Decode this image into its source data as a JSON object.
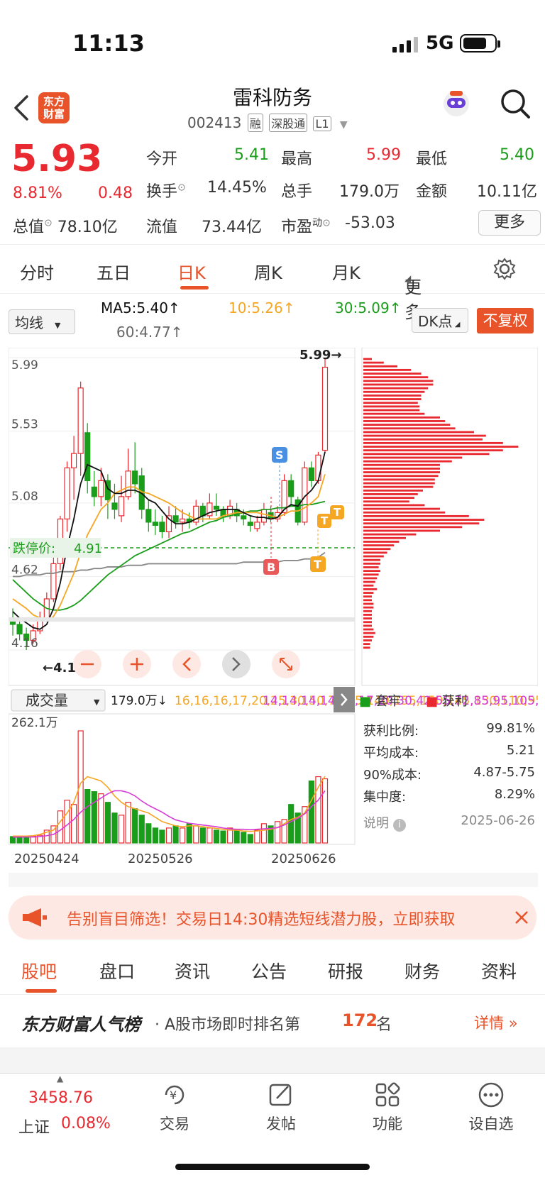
{
  "status_bar": {
    "time": "11:13",
    "network": "5G"
  },
  "header": {
    "logo_line1": "东方",
    "logo_line2": "财富",
    "title": "雷科防务",
    "code": "002413",
    "tags": [
      "融",
      "深股通",
      "L1"
    ]
  },
  "quote": {
    "price": "5.93",
    "change_pct": "8.81%",
    "change": "0.48",
    "open_label": "今开",
    "open": "5.41",
    "high_label": "最高",
    "high": "5.99",
    "low_label": "最低",
    "low": "5.40",
    "turnover_label": "换手",
    "turnover": "14.45%",
    "volume_label": "总手",
    "volume": "179.0万",
    "amount_label": "金额",
    "amount": "10.11亿",
    "total_cap_label": "总值",
    "total_cap": "78.10亿",
    "float_cap_label": "流值",
    "float_cap": "73.44亿",
    "pe_label": "市盈",
    "pe_sup": "动",
    "pe": "-53.03",
    "more_label": "更多"
  },
  "chart_tabs": [
    "分时",
    "五日",
    "日K",
    "周K",
    "月K",
    "更多"
  ],
  "active_chart_tab": "日K",
  "ma_bar": {
    "selector": "均线",
    "ma5": "MA5:5.40↑",
    "ma10": "10:5.26↑",
    "ma30": "30:5.09↑",
    "ma60": "60:4.77↑",
    "dk_label": "DK点",
    "adjust_label": "不复权"
  },
  "colors": {
    "up": "#e8292f",
    "down": "#1a9d1a",
    "accent": "#e8532a",
    "ma5": "#111111",
    "ma10": "#f5a623",
    "ma30": "#1a9d1a",
    "ma60": "#888888",
    "vol_ma2": "#d63bd6"
  },
  "chart_data": {
    "type": "candlestick",
    "y_ticks": [
      "5.99",
      "5.53",
      "5.08",
      "4.62",
      "4.16"
    ],
    "ylim": [
      4.16,
      5.99
    ],
    "high_marker": "5.99→",
    "low_marker": "←4.16",
    "limit_down_label": "跌停价:",
    "limit_down_value": "4.91",
    "signal_labels": [
      "S",
      "B",
      "T",
      "T",
      "T"
    ],
    "x_labels": [
      "20250424",
      "20250526",
      "20250626"
    ],
    "candles": [
      [
        4.35,
        4.32,
        4.42,
        4.25
      ],
      [
        4.32,
        4.26,
        4.36,
        4.22
      ],
      [
        4.26,
        4.22,
        4.3,
        4.16
      ],
      [
        4.22,
        4.28,
        4.32,
        4.2
      ],
      [
        4.28,
        4.36,
        4.4,
        4.26
      ],
      [
        4.36,
        4.48,
        4.52,
        4.34
      ],
      [
        4.48,
        4.7,
        4.74,
        4.46
      ],
      [
        4.7,
        4.98,
        5.0,
        4.66
      ],
      [
        4.98,
        5.3,
        5.34,
        4.9
      ],
      [
        5.3,
        5.39,
        5.5,
        5.1
      ],
      [
        5.39,
        5.8,
        5.84,
        5.25
      ],
      [
        5.52,
        5.22,
        5.58,
        5.14
      ],
      [
        5.18,
        5.12,
        5.28,
        5.06
      ],
      [
        5.12,
        5.22,
        5.3,
        5.06
      ],
      [
        5.22,
        5.1,
        5.26,
        4.98
      ],
      [
        5.08,
        5.04,
        5.2,
        4.98
      ],
      [
        5.0,
        5.12,
        5.25,
        4.96
      ],
      [
        5.12,
        5.28,
        5.42,
        5.1
      ],
      [
        5.28,
        5.2,
        5.46,
        5.14
      ],
      [
        5.25,
        5.04,
        5.3,
        4.98
      ],
      [
        5.04,
        4.96,
        5.1,
        4.9
      ],
      [
        4.96,
        4.94,
        5.04,
        4.88
      ],
      [
        4.96,
        4.9,
        5.0,
        4.86
      ],
      [
        4.9,
        5.0,
        5.06,
        4.86
      ],
      [
        5.0,
        4.96,
        5.06,
        4.92
      ],
      [
        4.96,
        4.98,
        5.04,
        4.9
      ],
      [
        4.98,
        4.96,
        5.02,
        4.92
      ],
      [
        4.96,
        5.06,
        5.1,
        4.94
      ],
      [
        5.06,
        5.0,
        5.08,
        4.96
      ],
      [
        5.0,
        5.08,
        5.14,
        4.98
      ],
      [
        5.06,
        5.04,
        5.14,
        5.0
      ],
      [
        5.04,
        5.0,
        5.06,
        4.96
      ],
      [
        5.0,
        5.06,
        5.1,
        4.98
      ],
      [
        5.04,
        5.0,
        5.08,
        4.96
      ],
      [
        5.0,
        4.98,
        5.04,
        4.94
      ],
      [
        4.96,
        4.94,
        5.0,
        4.9
      ],
      [
        4.92,
        4.96,
        5.0,
        4.9
      ],
      [
        4.96,
        5.04,
        5.08,
        4.94
      ],
      [
        5.02,
        4.98,
        5.06,
        4.96
      ],
      [
        4.98,
        5.02,
        5.06,
        4.96
      ],
      [
        5.02,
        5.22,
        5.26,
        5.0
      ],
      [
        5.22,
        5.12,
        5.26,
        5.06
      ],
      [
        5.1,
        4.96,
        5.12,
        4.94
      ],
      [
        4.96,
        5.3,
        5.34,
        4.94
      ],
      [
        5.3,
        5.22,
        5.34,
        5.18
      ],
      [
        5.22,
        5.38,
        5.4,
        5.2
      ],
      [
        5.41,
        5.93,
        5.99,
        5.4
      ]
    ],
    "ma5": [
      4.4,
      4.36,
      4.33,
      4.3,
      4.29,
      4.32,
      4.42,
      4.58,
      4.8,
      4.98,
      5.2,
      5.32,
      5.3,
      5.28,
      5.17,
      5.14,
      5.14,
      5.16,
      5.16,
      5.14,
      5.1,
      5.08,
      5.03,
      4.98,
      4.95,
      4.95,
      4.96,
      4.98,
      5.0,
      5.02,
      5.03,
      5.04,
      5.04,
      5.04,
      5.02,
      5.0,
      4.99,
      4.99,
      4.98,
      4.99,
      5.04,
      5.07,
      5.06,
      5.12,
      5.16,
      5.22,
      5.4
    ],
    "ma10": [
      4.48,
      4.45,
      4.42,
      4.38,
      4.36,
      4.34,
      4.37,
      4.44,
      4.54,
      4.64,
      4.77,
      4.88,
      4.96,
      5.04,
      5.08,
      5.14,
      5.16,
      5.18,
      5.18,
      5.15,
      5.14,
      5.12,
      5.1,
      5.08,
      5.05,
      5.02,
      5.0,
      4.98,
      4.98,
      4.98,
      4.98,
      5.0,
      5.01,
      5.02,
      5.02,
      5.02,
      5.02,
      5.01,
      5.0,
      4.99,
      5.01,
      5.03,
      5.03,
      5.05,
      5.08,
      5.12,
      5.26
    ],
    "ma30": [
      4.6,
      4.56,
      4.52,
      4.48,
      4.45,
      4.42,
      4.41,
      4.41,
      4.42,
      4.44,
      4.47,
      4.51,
      4.55,
      4.59,
      4.63,
      4.66,
      4.69,
      4.72,
      4.75,
      4.77,
      4.79,
      4.81,
      4.83,
      4.85,
      4.87,
      4.89,
      4.9,
      4.92,
      4.94,
      4.96,
      4.97,
      4.99,
      5.0,
      5.01,
      5.02,
      5.03,
      5.03,
      5.04,
      5.04,
      5.05,
      5.05,
      5.06,
      5.06,
      5.07,
      5.07,
      5.08,
      5.09
    ],
    "ma60": [
      4.62,
      4.62,
      4.63,
      4.63,
      4.63,
      4.64,
      4.64,
      4.65,
      4.65,
      4.65,
      4.66,
      4.66,
      4.67,
      4.67,
      4.68,
      4.68,
      4.68,
      4.69,
      4.69,
      4.69,
      4.7,
      4.7,
      4.7,
      4.7,
      4.7,
      4.7,
      4.7,
      4.7,
      4.7,
      4.7,
      4.7,
      4.7,
      4.7,
      4.7,
      4.71,
      4.71,
      4.71,
      4.71,
      4.71,
      4.71,
      4.72,
      4.72,
      4.72,
      4.73,
      4.73,
      4.74,
      4.77
    ],
    "chips_profit": [
      0.05,
      0.12,
      0.2,
      0.28,
      0.34,
      0.38,
      0.41,
      0.41,
      0.38,
      0.36,
      0.34,
      0.34,
      0.32,
      0.33,
      0.33,
      0.36,
      0.45,
      0.48,
      0.51,
      0.54,
      0.65,
      0.72,
      0.7,
      0.82,
      0.91,
      0.82,
      0.74,
      0.58,
      0.52,
      0.45,
      0.45,
      0.45,
      0.44,
      0.42,
      0.42,
      0.41,
      0.35,
      0.32,
      0.3,
      0.27,
      0.36,
      0.45,
      0.48,
      0.62,
      0.71,
      0.68,
      0.58,
      0.45,
      0.31,
      0.25,
      0.21,
      0.18,
      0.16,
      0.14,
      0.12,
      0.1,
      0.1,
      0.09,
      0.1,
      0.09,
      0.08,
      0.07,
      0.06,
      0.08,
      0.06,
      0.05,
      0.05,
      0.06,
      0.06,
      0.05,
      0.05,
      0.05,
      0.05,
      0.05,
      0.06,
      0.07,
      0.06,
      0.05,
      0.04,
      0.04
    ],
    "volume": {
      "header": "成交量",
      "current": "179.0万↓",
      "ma1": [
        16,
        16,
        16,
        17,
        20,
        25,
        30,
        50,
        70,
        95,
        140,
        155,
        150,
        145,
        130,
        110,
        95,
        85,
        80,
        75,
        70,
        60,
        50,
        45,
        40,
        38,
        40,
        40,
        38,
        36,
        34,
        32,
        30,
        30,
        28,
        27,
        28,
        30,
        32,
        36,
        45,
        55,
        60,
        70,
        100,
        130,
        156
      ],
      "ma2": [
        14,
        14,
        14,
        14,
        15,
        17,
        20,
        30,
        42,
        55,
        72,
        85,
        95,
        105,
        115,
        122,
        122,
        118,
        110,
        98,
        88,
        80,
        72,
        62,
        54,
        50,
        46,
        44,
        42,
        40,
        38,
        35,
        33,
        32,
        32,
        31,
        32,
        33,
        34,
        36,
        42,
        50,
        58,
        68,
        85,
        100,
        122
      ],
      "max_label": "262.1万",
      "bars": [
        15,
        15,
        14,
        16,
        18,
        30,
        40,
        75,
        100,
        90,
        262,
        125,
        120,
        115,
        95,
        70,
        65,
        95,
        80,
        65,
        45,
        35,
        30,
        35,
        40,
        35,
        45,
        40,
        35,
        35,
        30,
        28,
        35,
        30,
        25,
        20,
        30,
        45,
        40,
        50,
        55,
        90,
        70,
        85,
        145,
        155,
        150
      ]
    }
  },
  "chip_panel": {
    "legend_trapped": "套牢",
    "legend_profit": "获利",
    "profit_ratio_label": "获利比例:",
    "profit_ratio": "99.81%",
    "avg_cost_label": "平均成本:",
    "avg_cost": "5.21",
    "cost90_label": "90%成本:",
    "cost90": "4.87-5.75",
    "concentration_label": "集中度:",
    "concentration": "8.29%",
    "note_label": "说明",
    "date": "2025-06-26"
  },
  "banner": {
    "text": "告别盲目筛选！交易日14:30精选短线潜力股，立即获取"
  },
  "bottom_tabs": [
    "股吧",
    "盘口",
    "资讯",
    "公告",
    "研报",
    "财务",
    "资料"
  ],
  "active_bottom_tab": "股吧",
  "rank": {
    "brand": "东方财富人气榜",
    "text_pre": "· A股市场即时排名第",
    "rank": "172",
    "text_post": "名",
    "detail": "详情"
  },
  "bottom_nav": {
    "index_value": "3458.76",
    "index_name": "上证",
    "index_change": "0.08%",
    "items": [
      "交易",
      "发帖",
      "功能",
      "设自选"
    ]
  }
}
